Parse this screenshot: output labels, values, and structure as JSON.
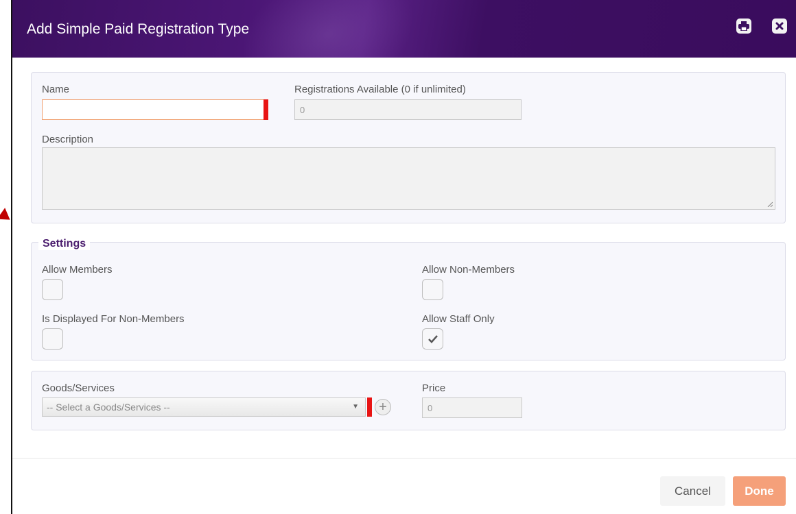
{
  "dialog": {
    "title": "Add Simple Paid Registration Type"
  },
  "fields": {
    "name_label": "Name",
    "name_value": "",
    "registrations_label": "Registrations Available (0 if unlimited)",
    "registrations_value": "0",
    "description_label": "Description",
    "description_value": ""
  },
  "settings": {
    "legend": "Settings",
    "allow_members_label": "Allow Members",
    "allow_members_checked": false,
    "allow_non_members_label": "Allow Non-Members",
    "allow_non_members_checked": false,
    "displayed_non_members_label": "Is Displayed For Non-Members",
    "displayed_non_members_checked": false,
    "allow_staff_only_label": "Allow Staff Only",
    "allow_staff_only_checked": true
  },
  "goods": {
    "label": "Goods/Services",
    "select_value": "-- Select a Goods/Services --",
    "price_label": "Price",
    "price_value": "0"
  },
  "footer": {
    "cancel_label": "Cancel",
    "done_label": "Done"
  },
  "colors": {
    "header": "#3c1060",
    "required": "#e81414",
    "done": "#f5a07a",
    "legend": "#4a1c6d"
  },
  "icons": {
    "print": "print-icon",
    "close": "close-icon",
    "check": "checkmark-icon",
    "add": "plus-circle-icon",
    "dropdown": "triangle-down-icon"
  }
}
